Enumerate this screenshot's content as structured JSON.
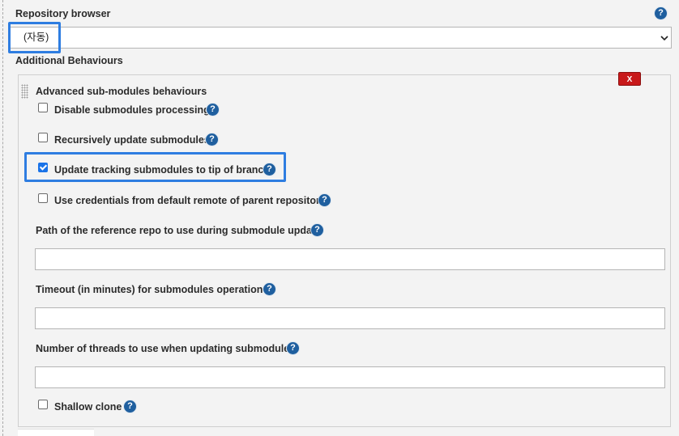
{
  "repository_browser": {
    "label": "Repository browser",
    "help": "?",
    "selected": "(자동)",
    "chevron": "⌄"
  },
  "additional_behaviours": {
    "label": "Additional Behaviours"
  },
  "panel": {
    "title": "Advanced sub-modules behaviours",
    "delete_label": "X",
    "options": [
      {
        "label": "Disable submodules processing",
        "checked": false,
        "help": "?"
      },
      {
        "label": "Recursively update submodules",
        "checked": false,
        "help": "?"
      },
      {
        "label": "Update tracking submodules to tip of branch",
        "checked": true,
        "help": "?"
      },
      {
        "label": "Use credentials from default remote of parent repository",
        "checked": false,
        "help": "?"
      }
    ],
    "fields": [
      {
        "label": "Path of the reference repo to use during submodule update",
        "value": "",
        "help": "?"
      },
      {
        "label": "Timeout (in minutes) for submodules operations",
        "value": "",
        "help": "?"
      },
      {
        "label": "Number of threads to use when updating submodules",
        "value": "",
        "help": "?"
      }
    ],
    "shallow_clone": {
      "label": "Shallow clone",
      "checked": false,
      "help": "?"
    }
  },
  "colors": {
    "accent_highlight": "#2e7de1",
    "help_icon": "#1f5f9f",
    "delete_button": "#c8191a",
    "background": "#f3f3f3"
  }
}
